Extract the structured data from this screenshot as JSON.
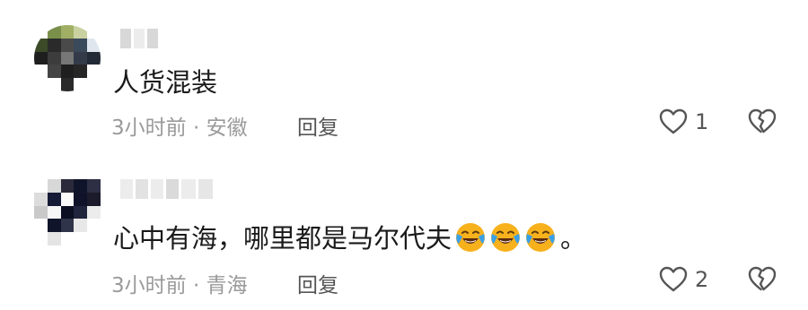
{
  "comments": [
    {
      "username": "",
      "text": "人货混装",
      "meta": "3小时前 · 安徽",
      "reply_label": "回复",
      "like_count": "1",
      "emoji_count": 0
    },
    {
      "username": "",
      "text": "心中有海，哪里都是马尔代夫",
      "text_suffix": "。",
      "meta": "3小时前 · 青海",
      "reply_label": "回复",
      "like_count": "2",
      "emoji_count": 3
    }
  ],
  "icons": {
    "like": "heart-outline-icon",
    "dislike": "broken-heart-icon",
    "emoji": "loudly-crying-laughing-emoji"
  },
  "colors": {
    "text": "#1a1a1a",
    "meta": "#9a9a9a",
    "reply": "#555555",
    "emoji": "#f7b11c"
  }
}
